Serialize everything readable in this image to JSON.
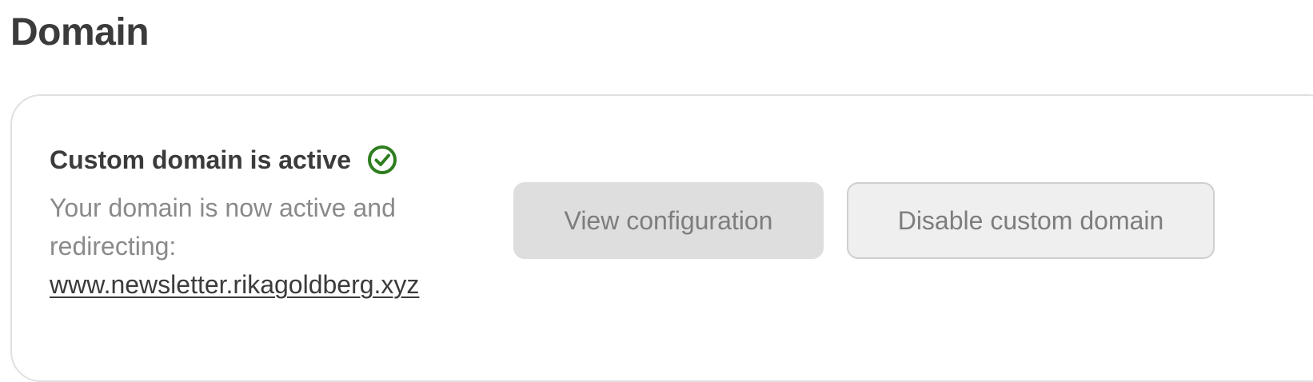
{
  "page": {
    "title": "Domain"
  },
  "domain_card": {
    "status_title": "Custom domain is active",
    "status_icon": "check-circle-icon",
    "status_color": "#2e7d1f",
    "description": "Your domain is now active and redirecting:",
    "domain": "www.newsletter.rikagoldberg.xyz",
    "buttons": {
      "view_configuration": "View configuration",
      "disable_custom_domain": "Disable custom domain"
    }
  }
}
